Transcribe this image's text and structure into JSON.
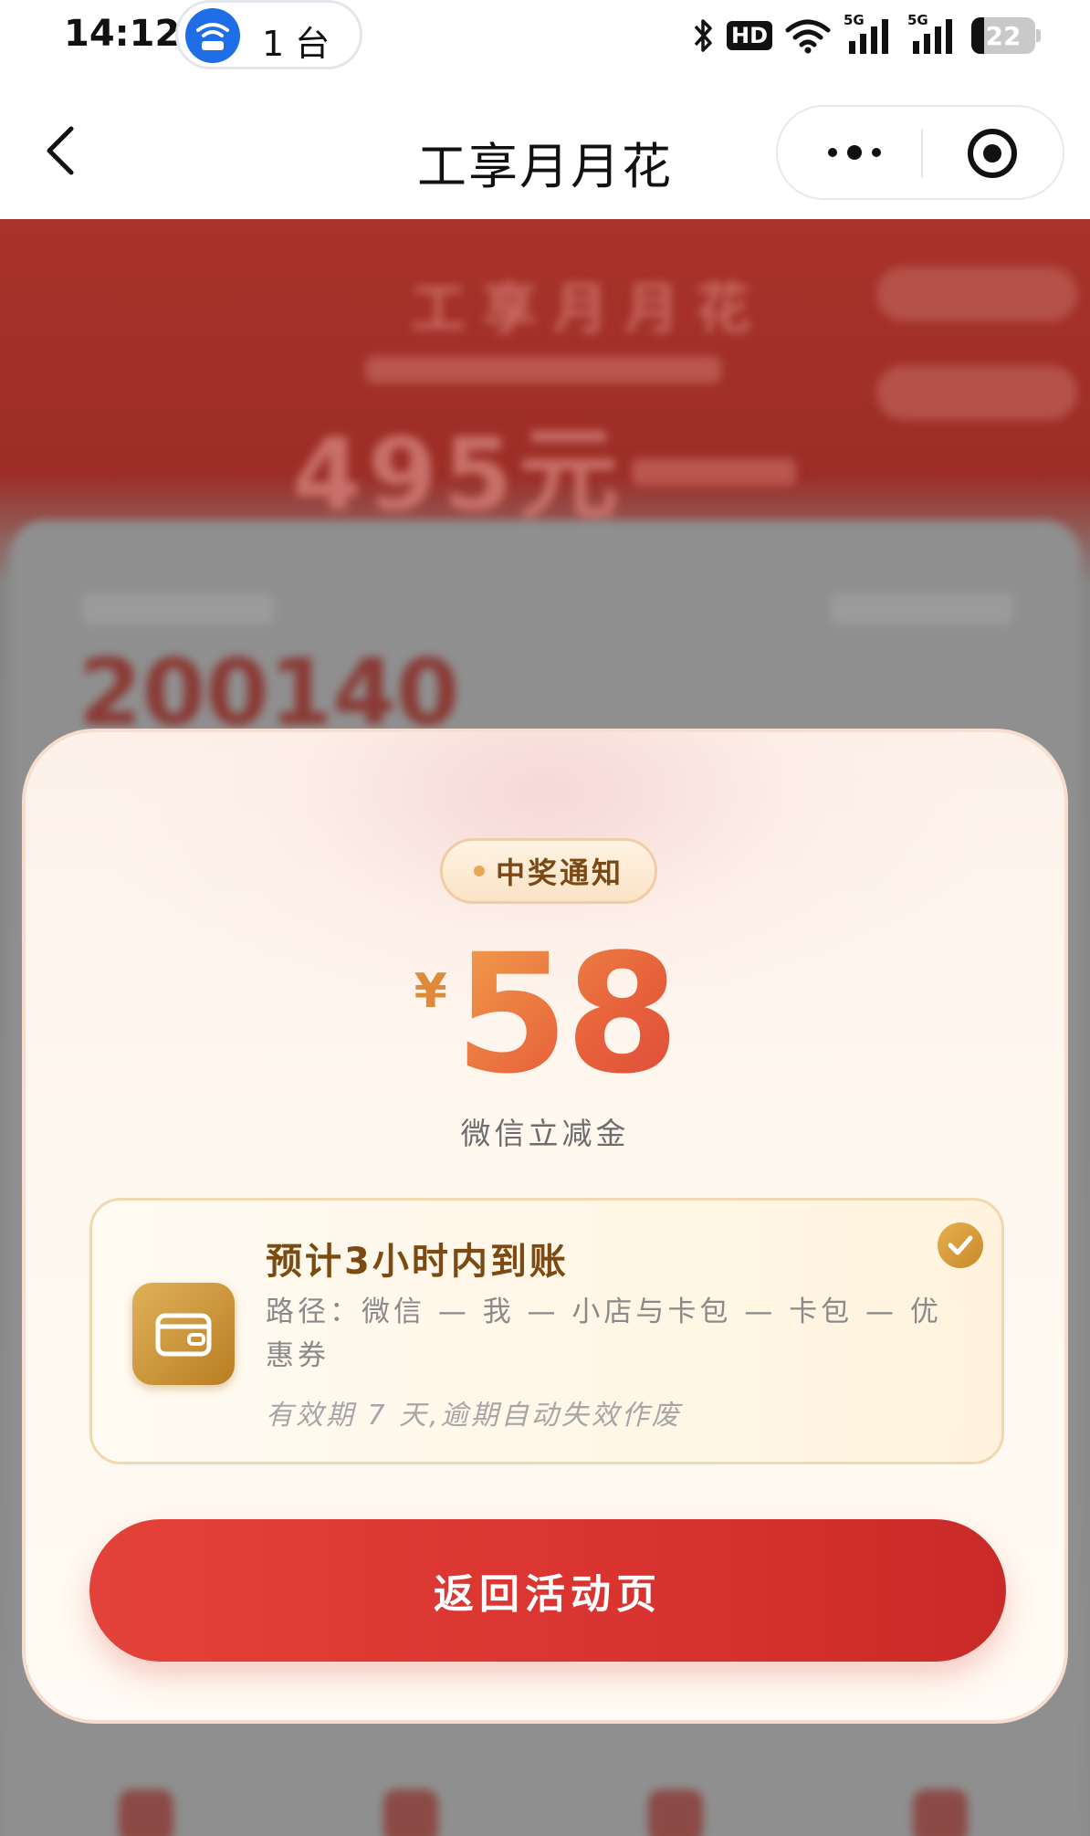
{
  "status_bar": {
    "time": "14:12",
    "hotspot_count": "1 台",
    "hd_label": "HD",
    "network_label_1": "5G",
    "network_label_2": "5G",
    "battery_level": "22"
  },
  "nav": {
    "title": "工享月月花"
  },
  "background_page": {
    "title": "工享月月花",
    "amount": "495元",
    "card_number": "200140"
  },
  "modal": {
    "badge": "中奖通知",
    "currency_symbol": "¥",
    "amount": "58",
    "amount_label": "微信立减金",
    "info": {
      "title": "预计3小时内到账",
      "path": "路径：微信 — 我 — 小店与卡包 — 卡包 — 优惠券",
      "note": "有效期 7 天,逾期自动失效作废"
    },
    "button_label": "返回活动页"
  },
  "colors": {
    "accent_red": "#dd3a34",
    "gold": "#c9892b",
    "amount_gradient_start": "#f1a04b",
    "amount_gradient_end": "#dd4b3a"
  },
  "icons": {
    "hotspot": "hotspot-icon",
    "bluetooth": "bluetooth-icon",
    "wifi": "wifi-icon",
    "signal": "signal-icon",
    "battery": "battery-icon",
    "back": "back-arrow-icon",
    "more": "more-dots-icon",
    "close": "close-miniprogram-icon",
    "wallet": "wallet-icon",
    "check": "check-icon"
  }
}
